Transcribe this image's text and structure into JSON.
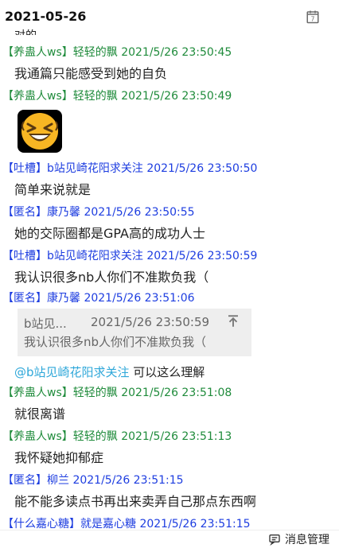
{
  "date": "2021-05-26",
  "cut_text": "对的",
  "messages": [
    {
      "header": "【养蛊人ws】轻轻的飘 2021/5/26 23:50:45",
      "text": "我通篇只能感受到她的自负"
    },
    {
      "header": "【养蛊人ws】轻轻的飘 2021/5/26 23:50:49",
      "text": ""
    },
    {
      "header": "【吐槽】b站见崎花阳求关注 2021/5/26 23:50:50",
      "text": "简单来说就是"
    },
    {
      "header": "【匿名】康乃馨 2021/5/26 23:50:55",
      "text": "她的交际圈都是GPA高的成功人士"
    },
    {
      "header": "【吐槽】b站见崎花阳求关注 2021/5/26 23:50:59",
      "text": "我认识很多nb人你们不准欺负我（"
    },
    {
      "header": "【匿名】康乃馨 2021/5/26 23:51:06",
      "text": ""
    },
    {
      "header": "【养蛊人ws】轻轻的飘 2021/5/26 23:51:08",
      "text": "就很离谱"
    },
    {
      "header": "【养蛊人ws】轻轻的飘 2021/5/26 23:51:13",
      "text": "我怀疑她抑郁症"
    },
    {
      "header": "【匿名】柳兰 2021/5/26 23:51:15",
      "text": "能不能多读点书再出来卖弄自己那点东西啊"
    },
    {
      "header": "【什么嘉心糖】就是嘉心糖 2021/5/26 23:51:15",
      "text": ""
    }
  ],
  "quote": {
    "author": "b站见...",
    "time": "2021/5/26 23:50:59",
    "text": "我认识很多nb人你们不准欺负我（"
  },
  "reply": {
    "mention": "@b站见崎花阳求关注",
    "text": " 可以这么理解"
  },
  "bottom": {
    "manage_label": "消息管理"
  },
  "colors": {
    "green": "#1f8b3b",
    "blue": "#1d3de0",
    "mention": "#2ea7d9"
  }
}
